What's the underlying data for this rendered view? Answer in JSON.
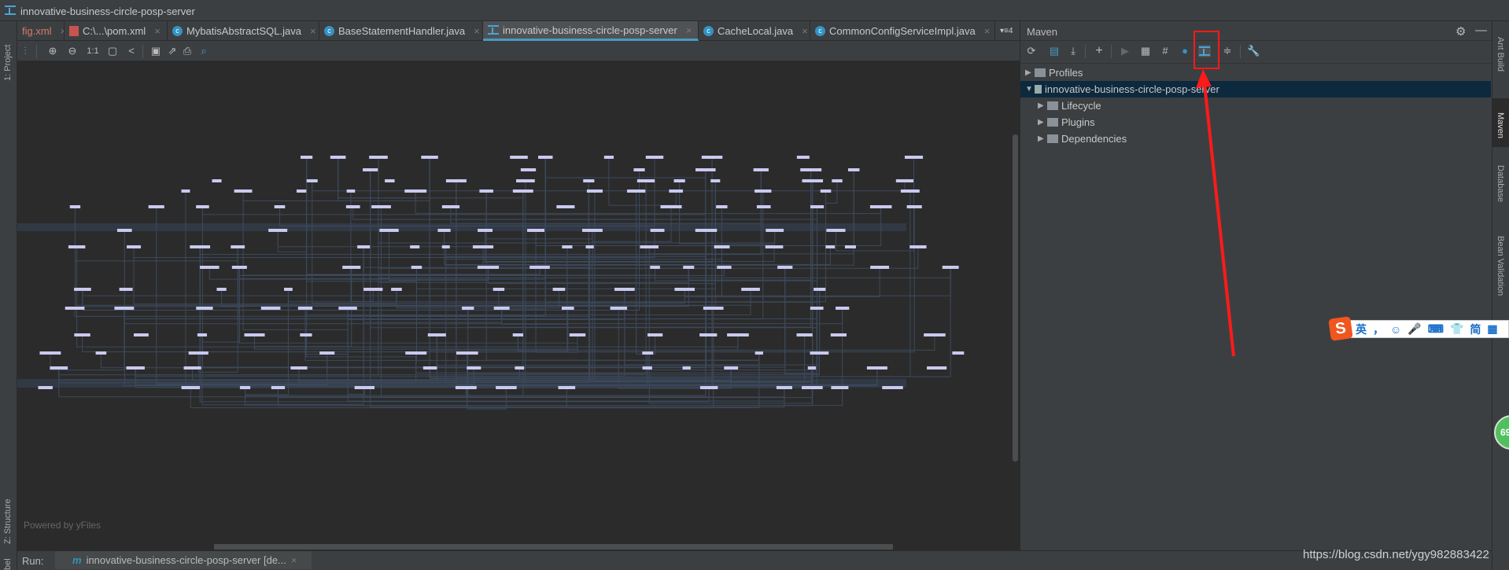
{
  "window": {
    "title": "innovative-business-circle-posp-server"
  },
  "left_strip": {
    "project": "1: Project",
    "structure": "Z: Structure",
    "label": "bel"
  },
  "tabs": [
    {
      "label": "fig.xml",
      "icon": "xml-icon",
      "active": false
    },
    {
      "label": "C:\\...\\pom.xml",
      "icon": "maven-xml-icon",
      "active": false
    },
    {
      "label": "MybatisAbstractSQL.java",
      "icon": "class-icon",
      "active": false
    },
    {
      "label": "BaseStatementHandler.java",
      "icon": "class-icon",
      "active": false
    },
    {
      "label": "innovative-business-circle-posp-server",
      "icon": "diagram-icon",
      "active": true
    },
    {
      "label": "CacheLocal.java",
      "icon": "class-icon",
      "active": false
    },
    {
      "label": "CommonConfigServiceImpl.java",
      "icon": "class-icon",
      "active": false
    }
  ],
  "tabs_overflow": "▾≡4",
  "graph_toolbar": {
    "zoom_actual": "1:1"
  },
  "canvas": {
    "powered_by": "Powered by yFiles"
  },
  "run": {
    "label": "Run:",
    "config": "innovative-business-circle-posp-server [de...",
    "close": "×"
  },
  "maven": {
    "title": "Maven",
    "tree": [
      {
        "label": "Profiles",
        "expanded": false,
        "selected": false,
        "level": 0
      },
      {
        "label": "innovative-business-circle-posp-server",
        "expanded": true,
        "selected": true,
        "level": 0
      },
      {
        "label": "Lifecycle",
        "expanded": false,
        "selected": false,
        "level": 1
      },
      {
        "label": "Plugins",
        "expanded": false,
        "selected": false,
        "level": 1
      },
      {
        "label": "Dependencies",
        "expanded": false,
        "selected": false,
        "level": 1
      }
    ]
  },
  "right_strip": {
    "ant": "Ant Build",
    "maven": "Maven",
    "database": "Database",
    "bean": "Bean Validation"
  },
  "ime": {
    "lang": "英",
    "items": [
      "，",
      "☺",
      "🎤",
      "⌨",
      "👕",
      "简",
      "▦"
    ]
  },
  "badge": {
    "value": "69"
  },
  "watermark": "https://blog.csdn.net/ygy982883422",
  "colors": {
    "accent": "#4a9ac4",
    "selection": "#0d293e",
    "annotation": "#ff1a1a",
    "node": "#c9c9f0"
  }
}
